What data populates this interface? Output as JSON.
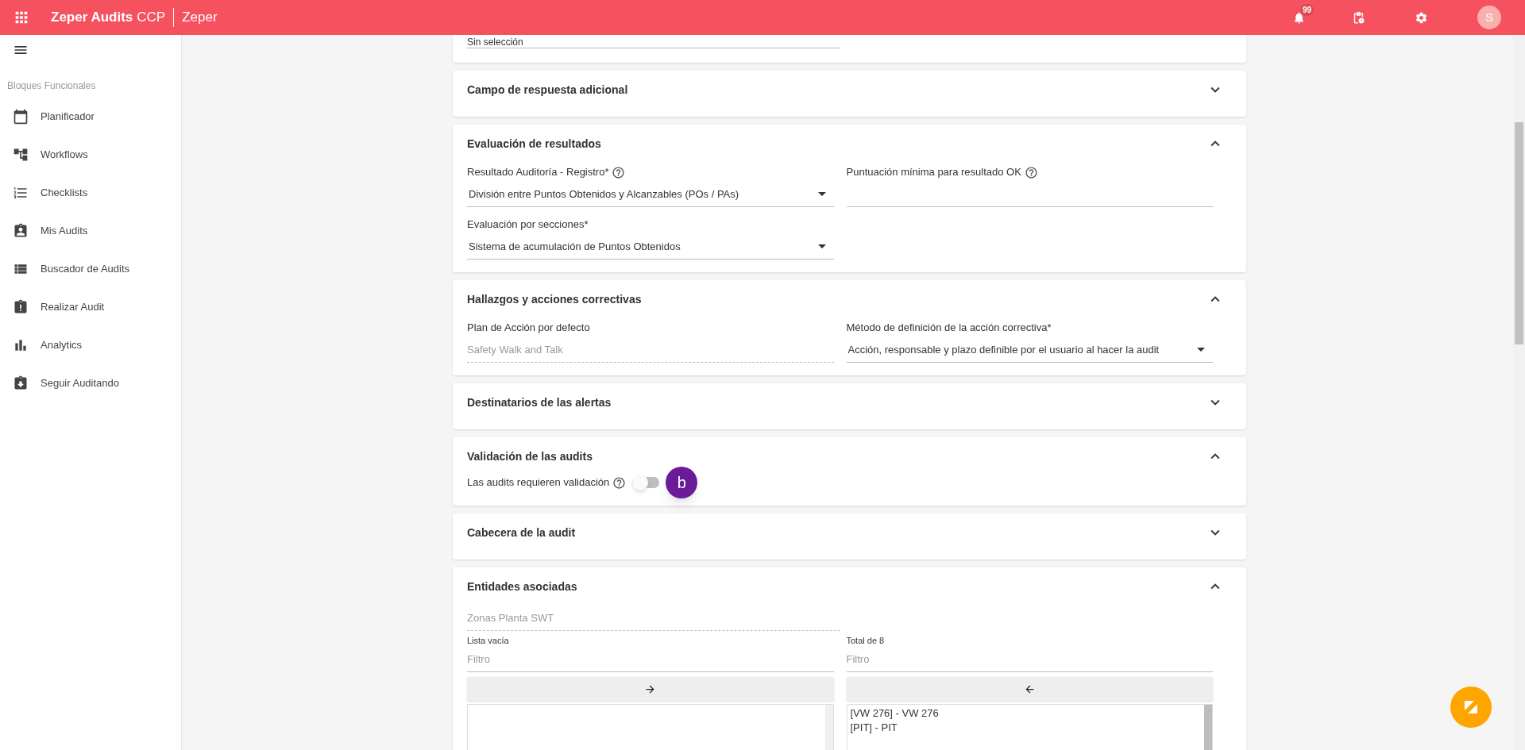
{
  "header": {
    "app_name": "Zeper Audits",
    "app_suffix": "CCP",
    "company": "Zeper",
    "notification_count": "99",
    "avatar_letter": "S"
  },
  "sidebar": {
    "heading": "Bloques Funcionales",
    "items": [
      {
        "label": "Planificador"
      },
      {
        "label": "Workflows"
      },
      {
        "label": "Checklists"
      },
      {
        "label": "Mis Audits"
      },
      {
        "label": "Buscador de Audits"
      },
      {
        "label": "Realizar Audit"
      },
      {
        "label": "Analytics"
      },
      {
        "label": "Seguir Auditando"
      }
    ]
  },
  "top_field": {
    "value": "Sin selección"
  },
  "sections": [
    {
      "title": "Campo de respuesta adicional",
      "expanded": false
    },
    {
      "title": "Evaluación de resultados",
      "expanded": true,
      "fields": [
        {
          "kind": "select",
          "label": "Resultado Auditoría - Registro*",
          "help": true,
          "value": "División entre Puntos Obtenidos y Alcanzables (POs / PAs)"
        },
        {
          "kind": "input",
          "label": "Puntuación mínima para resultado OK",
          "help": true
        },
        {
          "kind": "select",
          "label": "Evaluación por secciones*",
          "help": false,
          "value": "Sistema de acumulación de Puntos Obtenidos"
        }
      ]
    },
    {
      "title": "Hallazgos y acciones correctivas",
      "expanded": true,
      "fields": [
        {
          "kind": "readonly",
          "label": "Plan de Acción por defecto",
          "value": "Safety Walk and Talk"
        },
        {
          "kind": "select",
          "label": "Método de definición de la acción correctiva*",
          "help": false,
          "value": "Acción, responsable y plazo definible por el usuario al hacer la audit"
        }
      ]
    },
    {
      "title": "Destinatarios de las alertas",
      "expanded": false
    },
    {
      "title": "Validación de las audits",
      "expanded": true,
      "fields": [
        {
          "kind": "toggle",
          "label": "Las audits requieren validación",
          "help": true,
          "on": false
        }
      ]
    },
    {
      "title": "Cabecera de la audit",
      "expanded": false
    },
    {
      "title": "Entidades asociadas",
      "expanded": true,
      "fields": [
        {
          "kind": "readonly",
          "value": "Zonas Planta SWT"
        },
        {
          "kind": "dual_list",
          "left": {
            "caption": "Lista vacía",
            "filter_placeholder": "Filtro"
          },
          "right": {
            "caption": "Total de 8",
            "filter_placeholder": "Filtro",
            "items": [
              "[VW 276] - VW 276",
              "[PIT] - PIT"
            ]
          }
        }
      ]
    }
  ],
  "overlay_badge": "b"
}
